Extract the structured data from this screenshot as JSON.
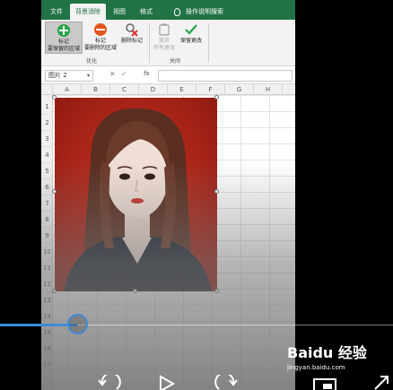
{
  "ribbon": {
    "tabs": [
      {
        "label": "文件",
        "active": false
      },
      {
        "label": "背景消除",
        "active": true
      },
      {
        "label": "视图",
        "active": false
      },
      {
        "label": "格式",
        "active": false
      }
    ],
    "tell_me": "操作说明搜索",
    "buttons": [
      {
        "line1": "标记",
        "line2": "要保留的区域",
        "icon": "plus-icon",
        "color": "#27a349"
      },
      {
        "line1": "标记",
        "line2": "要删除的区域",
        "icon": "minus-icon",
        "color": "#e2551e"
      },
      {
        "line1": "删除标记",
        "line2": "",
        "icon": "delete-mark-icon",
        "color": "#d13438"
      },
      {
        "line1": "放弃",
        "line2": "所有更改",
        "icon": "discard-icon",
        "color": "#a0a0a0"
      },
      {
        "line1": "保留更改",
        "line2": "",
        "icon": "checkmark-icon",
        "color": "#27a349"
      }
    ],
    "groups": {
      "refine": "优化",
      "close": "关闭"
    }
  },
  "formula_bar": {
    "name_box": "图片 2",
    "fx": "fx",
    "value": ""
  },
  "columns": [
    "A",
    "B",
    "C",
    "D",
    "E",
    "F",
    "G",
    "H"
  ],
  "rows": [
    "1",
    "2",
    "3",
    "4",
    "5",
    "6",
    "7",
    "8",
    "9",
    "10",
    "11",
    "12",
    "13",
    "14",
    "15",
    "16",
    "17"
  ],
  "video": {
    "progress": 0.2
  },
  "watermark": {
    "logo": "Baidu 经验",
    "url": "jingyan.baidu.com"
  },
  "colors": {
    "excel_green": "#217346",
    "seek_blue": "#3d8bd8",
    "photo_bg": "#b7261a"
  }
}
